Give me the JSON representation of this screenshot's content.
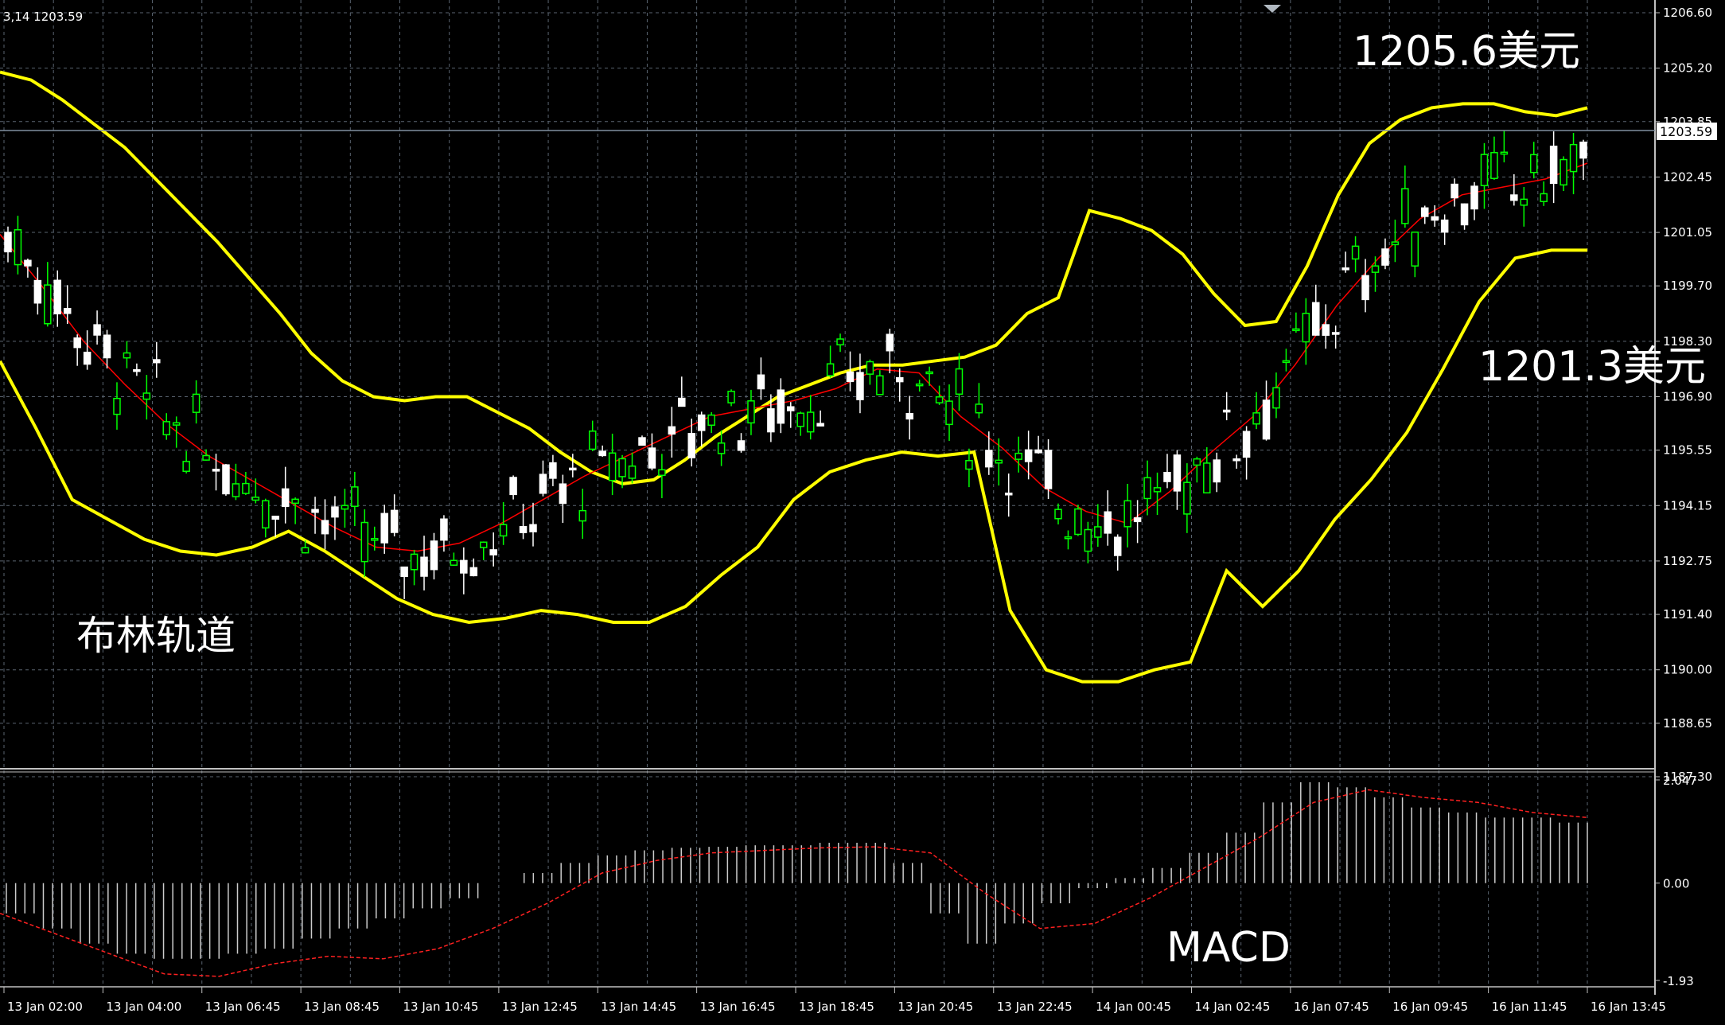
{
  "header": {
    "info": "3,14 1203.59"
  },
  "annotations": {
    "upper_band_label": "1205.6美元",
    "middle_band_label": "1201.3美元",
    "bollinger_label": "布林轨道",
    "macd_label": "MACD"
  },
  "price_tag": "1203.59",
  "colors": {
    "background": "#000000",
    "grid": "#5a6470",
    "bull_candle": "#00ff00",
    "bear_candle": "#ffffff",
    "bollinger": "#ffff00",
    "ma": "#ff0000",
    "macd_hist": "#cccccc",
    "macd_signal": "#ff2020"
  },
  "chart_data": [
    {
      "type": "candlestick",
      "indicator": "Bollinger Bands",
      "ylim": [
        1187.3,
        1206.6
      ],
      "y_ticks": [
        "1206.60",
        "1205.20",
        "1203.85",
        "1202.45",
        "1201.05",
        "1199.70",
        "1198.30",
        "1196.90",
        "1195.55",
        "1194.15",
        "1192.75",
        "1191.40",
        "1190.00",
        "1188.65",
        "1187.30"
      ],
      "x_ticks": [
        "13 Jan 02:00",
        "13 Jan 04:00",
        "13 Jan 06:45",
        "13 Jan 08:45",
        "13 Jan 10:45",
        "13 Jan 12:45",
        "13 Jan 14:45",
        "13 Jan 16:45",
        "13 Jan 18:45",
        "13 Jan 20:45",
        "13 Jan 22:45",
        "14 Jan 00:45",
        "14 Jan 02:45",
        "16 Jan 07:45",
        "16 Jan 09:45",
        "16 Jan 11:45",
        "16 Jan 13:45"
      ],
      "last_price": 1203.59,
      "bollinger_upper": [
        1205.1,
        1204.9,
        1204.4,
        1203.8,
        1203.2,
        1202.4,
        1201.6,
        1200.8,
        1199.9,
        1199.0,
        1198.0,
        1197.3,
        1196.9,
        1196.8,
        1196.9,
        1196.9,
        1196.5,
        1196.1,
        1195.5,
        1195.0,
        1194.7,
        1194.8,
        1195.3,
        1195.9,
        1196.4,
        1196.9,
        1197.2,
        1197.5,
        1197.7,
        1197.7,
        1197.8,
        1197.9,
        1198.2,
        1199.0,
        1199.4,
        1201.6,
        1201.4,
        1201.1,
        1200.5,
        1199.5,
        1198.7,
        1198.8,
        1200.2,
        1202.0,
        1203.3,
        1203.9,
        1204.2,
        1204.3,
        1204.3,
        1204.1,
        1204.0,
        1204.2
      ],
      "bollinger_lower": [
        1197.8,
        1196.1,
        1194.3,
        1193.8,
        1193.3,
        1193.0,
        1192.9,
        1193.1,
        1193.5,
        1193.0,
        1192.4,
        1191.8,
        1191.4,
        1191.2,
        1191.3,
        1191.5,
        1191.4,
        1191.2,
        1191.2,
        1191.6,
        1192.4,
        1193.1,
        1194.3,
        1195.0,
        1195.3,
        1195.5,
        1195.4,
        1195.5,
        1191.5,
        1190.0,
        1189.7,
        1189.7,
        1190.0,
        1190.2,
        1192.5,
        1191.6,
        1192.5,
        1193.8,
        1194.8,
        1196.0,
        1197.6,
        1199.3,
        1200.4,
        1200.6,
        1200.6
      ],
      "moving_average": [
        1201.0,
        1199.7,
        1198.3,
        1197.2,
        1196.2,
        1195.4,
        1194.8,
        1194.2,
        1193.6,
        1193.1,
        1193.0,
        1193.2,
        1193.7,
        1194.3,
        1194.9,
        1195.4,
        1195.9,
        1196.4,
        1196.6,
        1196.8,
        1197.1,
        1197.6,
        1197.5,
        1196.4,
        1195.6,
        1194.6,
        1194.0,
        1193.7,
        1194.5,
        1195.5,
        1196.4,
        1197.7,
        1199.2,
        1200.4,
        1201.4,
        1202.0,
        1202.2,
        1202.4,
        1202.8
      ],
      "candles_last": {
        "open": 1203.4,
        "high": 1204.1,
        "low": 1203.2,
        "close": 1203.59
      }
    },
    {
      "type": "histogram",
      "indicator": "MACD",
      "ylim": [
        -1.93,
        2.047
      ],
      "y_ticks": [
        "2.047",
        "0.00",
        "-1.93"
      ],
      "histogram": [
        -0.6,
        -0.9,
        -1.2,
        -1.4,
        -1.5,
        -1.5,
        -1.4,
        -1.3,
        -1.1,
        -0.9,
        -0.7,
        -0.5,
        -0.3,
        0.0,
        0.2,
        0.4,
        0.55,
        0.65,
        0.7,
        0.72,
        0.75,
        0.75,
        0.8,
        0.8,
        0.4,
        -0.6,
        -1.2,
        -0.8,
        -0.4,
        -0.1,
        0.1,
        0.3,
        0.6,
        1.0,
        1.6,
        2.0,
        1.9,
        1.7,
        1.5,
        1.4,
        1.3,
        1.3,
        1.2
      ],
      "signal": [
        -0.6,
        -1.0,
        -1.4,
        -1.8,
        -1.85,
        -1.6,
        -1.45,
        -1.5,
        -1.3,
        -0.9,
        -0.4,
        0.2,
        0.45,
        0.6,
        0.65,
        0.7,
        0.72,
        0.6,
        -0.2,
        -0.9,
        -0.8,
        -0.3,
        0.3,
        0.9,
        1.6,
        1.85,
        1.7,
        1.6,
        1.4,
        1.3
      ]
    }
  ]
}
